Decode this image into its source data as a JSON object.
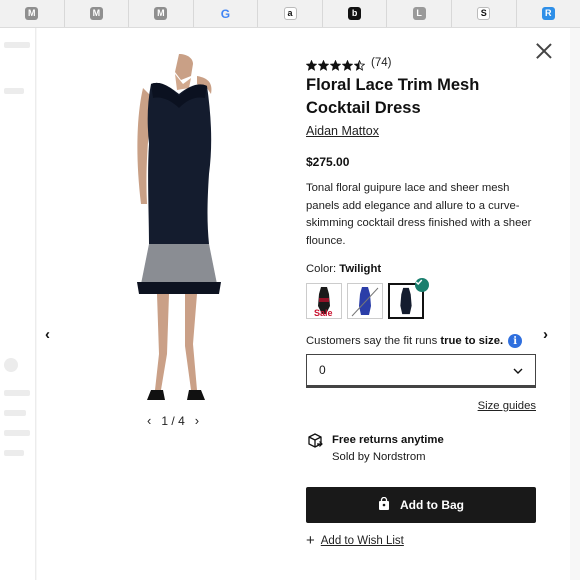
{
  "bookmarks": [
    {
      "glyph": "M",
      "icon": "medium-icon"
    },
    {
      "glyph": "M",
      "icon": "medium-icon"
    },
    {
      "glyph": "M",
      "icon": "medium-icon"
    },
    {
      "glyph": "G",
      "icon": "google-icon"
    },
    {
      "glyph": "a",
      "icon": "amazon-icon"
    },
    {
      "glyph": "b",
      "icon": "b-icon"
    },
    {
      "glyph": "L",
      "icon": "l-icon"
    },
    {
      "glyph": "S",
      "icon": "s-icon"
    },
    {
      "glyph": "R",
      "icon": "r-icon"
    }
  ],
  "product": {
    "rating": 4.5,
    "review_count": "(74)",
    "title": "Floral Lace Trim Mesh Cocktail Dress",
    "brand": "Aidan Mattox",
    "price": "$275.00",
    "description": "Tonal floral guipure lace and sheer mesh panels add elegance and allure to a curve-skimming cocktail dress finished with a sheer flounce."
  },
  "gallery": {
    "page_current": "1",
    "page_total": "4",
    "page_separator": "/"
  },
  "color": {
    "label": "Color:",
    "selected": "Twilight",
    "swatches": [
      {
        "name": "black-red",
        "badge": "Sale",
        "selected": false
      },
      {
        "name": "blue",
        "badge": "",
        "selected": false
      },
      {
        "name": "twilight",
        "badge": "",
        "selected": true
      }
    ]
  },
  "fit": {
    "prefix": "Customers say the fit runs",
    "emphasis": "true to size."
  },
  "size": {
    "value": "0"
  },
  "size_guides_label": "Size guides",
  "returns": {
    "title": "Free returns anytime",
    "sold_by": "Sold by Nordstrom"
  },
  "actions": {
    "add_to_bag": "Add to Bag",
    "wishlist": "Add to Wish List"
  },
  "colors": {
    "primary_button": "#191919",
    "sale": "#c8102e",
    "check": "#1a7f6e",
    "info": "#2f6fde"
  }
}
